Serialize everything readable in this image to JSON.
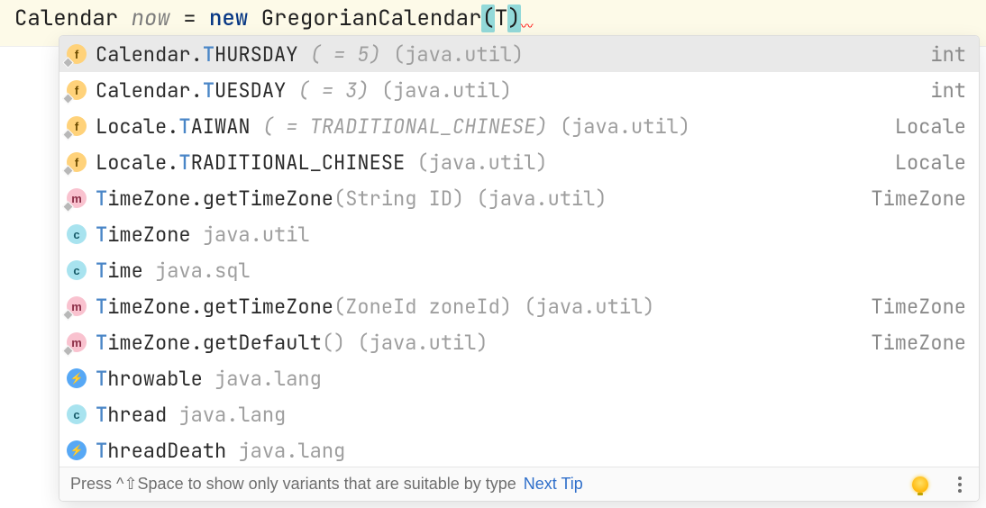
{
  "editor": {
    "type": "Calendar",
    "varName": "now",
    "eq": "=",
    "newKw": "new",
    "ctor": "GregorianCalendar",
    "open": "(",
    "arg": "T",
    "close": ")"
  },
  "items": [
    {
      "iconKind": "field",
      "diamond": true,
      "qualify": "Calendar.",
      "highlight": "T",
      "rest": "HURSDAY",
      "extra": " ( = 5)",
      "pkg": " (java.util)",
      "right": "int",
      "selected": true
    },
    {
      "iconKind": "field",
      "diamond": true,
      "qualify": "Calendar.",
      "highlight": "T",
      "rest": "UESDAY",
      "extra": " ( = 3)",
      "pkg": " (java.util)",
      "right": "int"
    },
    {
      "iconKind": "field",
      "diamond": true,
      "qualify": "Locale.",
      "highlight": "T",
      "rest": "AIWAN",
      "extra": " ( = TRADITIONAL_CHINESE)",
      "pkg": " (java.util)",
      "right": "Locale"
    },
    {
      "iconKind": "field",
      "diamond": true,
      "qualify": "Locale.",
      "highlight": "T",
      "rest": "RADITIONAL_CHINESE",
      "extra": "",
      "pkg": " (java.util)",
      "right": "Locale"
    },
    {
      "iconKind": "method",
      "diamond": true,
      "qualify": "",
      "highlight": "T",
      "rest": "imeZone.getTimeZone",
      "params": "(String ID)",
      "pkg": " (java.util)",
      "right": "TimeZone"
    },
    {
      "iconKind": "cls",
      "diamond": false,
      "qualify": "",
      "highlight": "T",
      "rest": "imeZone",
      "pkgOnly": "java.util"
    },
    {
      "iconKind": "cls",
      "diamond": false,
      "qualify": "",
      "highlight": "T",
      "rest": "ime",
      "pkgOnly": "java.sql"
    },
    {
      "iconKind": "method",
      "diamond": true,
      "qualify": "",
      "highlight": "T",
      "rest": "imeZone.getTimeZone",
      "params": "(ZoneId zoneId)",
      "pkg": " (java.util)",
      "right": "TimeZone"
    },
    {
      "iconKind": "method",
      "diamond": true,
      "qualify": "",
      "highlight": "T",
      "rest": "imeZone.getDefault",
      "params": "()",
      "pkg": " (java.util)",
      "right": "TimeZone"
    },
    {
      "iconKind": "bolt",
      "diamond": false,
      "qualify": "",
      "highlight": "T",
      "rest": "hrowable",
      "pkgOnly": "java.lang"
    },
    {
      "iconKind": "cls",
      "diamond": false,
      "qualify": "",
      "highlight": "T",
      "rest": "hread",
      "pkgOnly": "java.lang"
    },
    {
      "iconKind": "bolt",
      "diamond": false,
      "qualify": "",
      "highlight": "T",
      "rest": "hreadDeath",
      "pkgOnly": "java.lang"
    }
  ],
  "footer": {
    "hint": "Press ^⇧Space to show only variants that are suitable by type",
    "nextTip": "Next Tip"
  },
  "icons": {
    "field": "f",
    "method": "m",
    "cls": "c",
    "bolt": "⚡"
  }
}
